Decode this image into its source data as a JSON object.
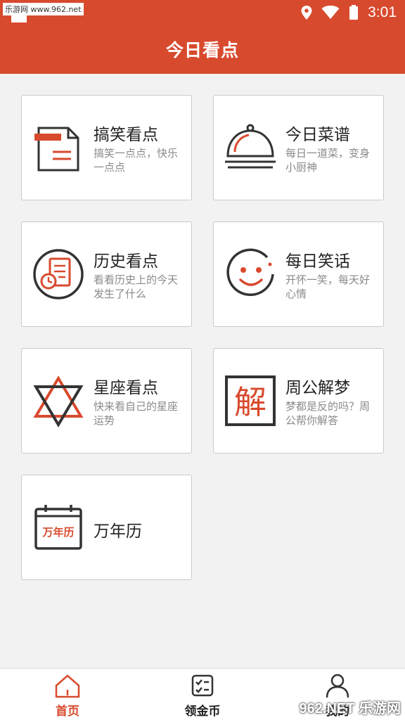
{
  "status_bar": {
    "site_label": "乐游网 www.962.net",
    "time": "3:01"
  },
  "header": {
    "title": "今日看点"
  },
  "cards": [
    {
      "title": "搞笑看点",
      "desc": "搞笑一点点，快乐一点点",
      "icon": "document-icon"
    },
    {
      "title": "今日菜谱",
      "desc": "每日一道菜，变身小厨神",
      "icon": "cloche-icon"
    },
    {
      "title": "历史看点",
      "desc": "看看历史上的今天发生了什么",
      "icon": "history-icon"
    },
    {
      "title": "每日笑话",
      "desc": "开怀一笑，每天好心情",
      "icon": "smiley-icon"
    },
    {
      "title": "星座看点",
      "desc": "快来看自己的星座运势",
      "icon": "star-icon"
    },
    {
      "title": "周公解梦",
      "desc": "梦都是反的吗？周公帮你解答",
      "icon": "dream-seal-icon",
      "seal_text": "解"
    },
    {
      "title": "万年历",
      "desc": "",
      "icon": "calendar-icon",
      "icon_text": "万年历"
    }
  ],
  "bottom_nav": [
    {
      "label": "首页",
      "active": true
    },
    {
      "label": "领金币",
      "active": false
    },
    {
      "label": "我的",
      "active": false
    }
  ],
  "watermark": "962.NET 乐游网",
  "colors": {
    "accent": "#d84a2e",
    "text": "#222222",
    "muted": "#8a8a8a"
  }
}
